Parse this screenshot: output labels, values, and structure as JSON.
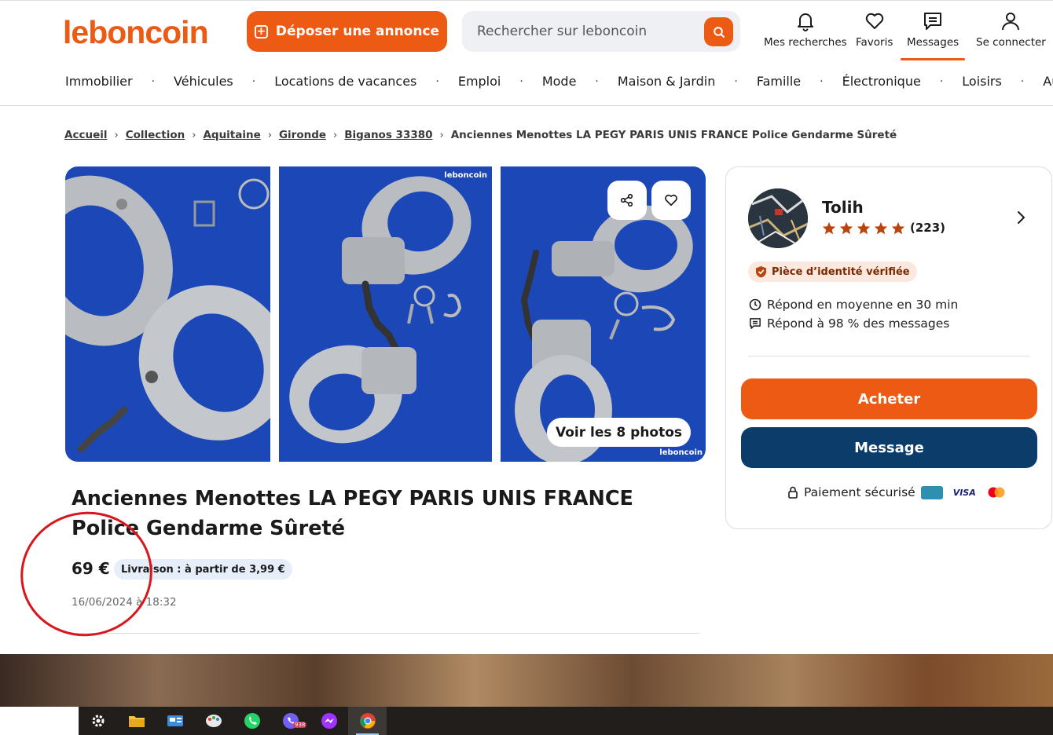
{
  "header": {
    "logo": "leboncoin",
    "post_label": "Déposer une annonce",
    "search_placeholder": "Rechercher sur leboncoin",
    "nav": {
      "searches": "Mes recherches",
      "favorites": "Favoris",
      "messages": "Messages",
      "login": "Se connecter"
    },
    "active_nav": "messages",
    "categories": [
      "Immobilier",
      "Véhicules",
      "Locations de vacances",
      "Emploi",
      "Mode",
      "Maison & Jardin",
      "Famille",
      "Électronique",
      "Loisirs",
      "Autres"
    ]
  },
  "breadcrumb": [
    "Accueil",
    "Collection",
    "Aquitaine",
    "Gironde",
    "Biganos 33380"
  ],
  "breadcrumb_current": "Anciennes Menottes LA PEGY PARIS UNIS FRANCE Police Gendarme Sûreté",
  "gallery": {
    "watermark": "leboncoin",
    "see_all": "Voir les 8 photos",
    "icons": [
      "share-icon",
      "heart-icon"
    ]
  },
  "listing": {
    "title": "Anciennes Menottes LA PEGY PARIS UNIS FRANCE Police Gendarme Sûreté",
    "price": "69 €",
    "delivery": "Livraison : à partir de 3,99 €",
    "date": "16/06/2024 à 18:32"
  },
  "seller": {
    "name": "Tolih",
    "rating_stars": 5,
    "review_count": "(223)",
    "badge": "Pièce d’identité vérifiée",
    "response_time": "Répond en moyenne en 30 min",
    "response_rate": "Répond à 98 % des messages",
    "buy_label": "Acheter",
    "message_label": "Message",
    "secure_label": "Paiement sécurisé",
    "card_brands": [
      "CB",
      "VISA",
      "Mastercard"
    ]
  },
  "colors": {
    "brand": "#ec5a13",
    "message_button": "#0c3d6a",
    "photo_background": "#1c48b7"
  },
  "taskbar": {
    "apps": [
      "gear-icon",
      "folder-icon",
      "news-icon",
      "paint-icon",
      "whatsapp-icon",
      "viber-icon",
      "messenger-icon",
      "chrome-icon"
    ],
    "viber_badge": "938"
  }
}
